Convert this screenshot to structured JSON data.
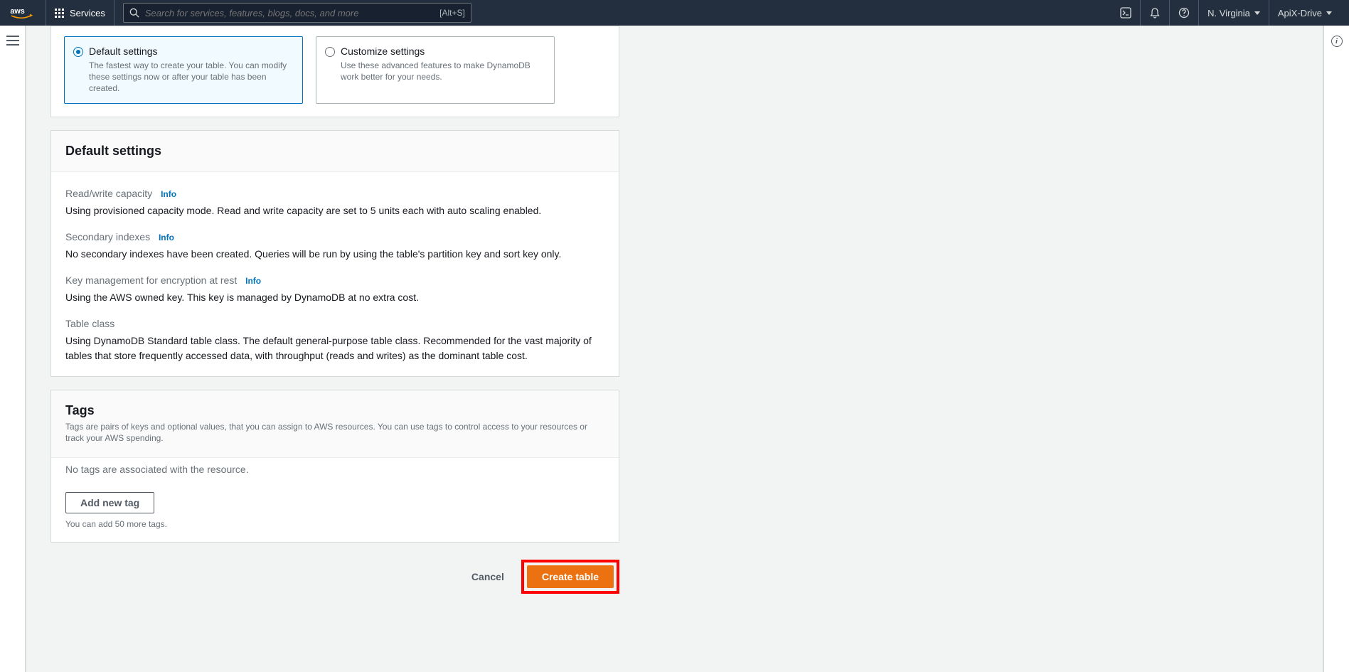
{
  "nav": {
    "services_label": "Services",
    "search_placeholder": "Search for services, features, blogs, docs, and more",
    "search_shortcut": "[Alt+S]",
    "region": "N. Virginia",
    "account": "ApiX-Drive"
  },
  "table_settings": {
    "options": [
      {
        "title": "Default settings",
        "desc": "The fastest way to create your table. You can modify these settings now or after your table has been created."
      },
      {
        "title": "Customize settings",
        "desc": "Use these advanced features to make DynamoDB work better for your needs."
      }
    ]
  },
  "default_settings": {
    "heading": "Default settings",
    "info_label": "Info",
    "rw_capacity": {
      "label": "Read/write capacity",
      "text": "Using provisioned capacity mode. Read and write capacity are set to 5 units each with auto scaling enabled."
    },
    "secondary_indexes": {
      "label": "Secondary indexes",
      "text": "No secondary indexes have been created. Queries will be run by using the table's partition key and sort key only."
    },
    "key_mgmt": {
      "label": "Key management for encryption at rest",
      "text": "Using the AWS owned key. This key is managed by DynamoDB at no extra cost."
    },
    "table_class": {
      "label": "Table class",
      "text": "Using DynamoDB Standard table class. The default general-purpose table class. Recommended for the vast majority of tables that store frequently accessed data, with throughput (reads and writes) as the dominant table cost."
    }
  },
  "tags": {
    "heading": "Tags",
    "description": "Tags are pairs of keys and optional values, that you can assign to AWS resources. You can use tags to control access to your resources or track your AWS spending.",
    "empty": "No tags are associated with the resource.",
    "add_btn": "Add new tag",
    "hint": "You can add 50 more tags."
  },
  "actions": {
    "cancel": "Cancel",
    "create": "Create table"
  }
}
